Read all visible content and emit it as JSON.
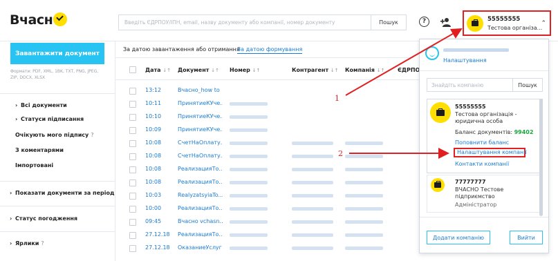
{
  "header": {
    "logo_text": "Вчасн",
    "search_placeholder": "Введіть ЄДРПОУ/ІПН, email, назву документу або компанії, номер документу",
    "search_button": "Пошук",
    "help_icon": "question-circle-icon",
    "add_user_icon": "add-user-icon",
    "account": {
      "id": "55555555",
      "name": "Тестова організа..."
    }
  },
  "sidebar": {
    "upload_button": "Завантажити документ",
    "formats": "Формати: PDF, XML, 1BK, TXT, PNG, JPEG, ZIP, DOCX, XLSX",
    "items": [
      {
        "label": "Всі документи",
        "chevron": true
      },
      {
        "label": "Статуси підписання",
        "chevron": true
      },
      {
        "label": "Очікують мого підпису",
        "help": "?"
      },
      {
        "label": "З коментарями"
      },
      {
        "label": "Імпортовані"
      },
      {
        "label": "Показати документи за період",
        "chevron": true
      },
      {
        "label": "Статус погодження",
        "chevron": true
      },
      {
        "label": "Ярлики",
        "chevron": true,
        "help": "?"
      }
    ]
  },
  "tabs": {
    "active": "За датою завантаження або отримання",
    "other": "За датою формування"
  },
  "table": {
    "columns": [
      "Дата",
      "Документ",
      "Номер",
      "Контрагент",
      "Компанія",
      "ЄДРПОУ"
    ],
    "sort_glyph": "↓↑",
    "rows": [
      {
        "time": "13:12",
        "doc": "Вчасно_how to",
        "blur": [
          false,
          false,
          false
        ]
      },
      {
        "time": "10:11",
        "doc": "ПринятиеКУче...",
        "blur": [
          true,
          false,
          false
        ]
      },
      {
        "time": "10:10",
        "doc": "ПринятиеКУче...",
        "blur": [
          true,
          false,
          false
        ]
      },
      {
        "time": "10:09",
        "doc": "ПринятиеКУче...",
        "blur": [
          true,
          false,
          false
        ]
      },
      {
        "time": "10:08",
        "doc": "СчетНаОплату...",
        "blur": [
          true,
          true,
          true
        ]
      },
      {
        "time": "10:08",
        "doc": "СчетНаОплату...",
        "blur": [
          true,
          true,
          true
        ]
      },
      {
        "time": "10:08",
        "doc": "РеализацияТо...",
        "blur": [
          true,
          true,
          true
        ]
      },
      {
        "time": "10:08",
        "doc": "РеализацияТо...",
        "blur": [
          true,
          true,
          true
        ]
      },
      {
        "time": "10:03",
        "doc": "RealyzatsyiaTo...",
        "blur": [
          true,
          true,
          true
        ]
      },
      {
        "time": "10:00",
        "doc": "РеализацияТо...",
        "blur": [
          true,
          true,
          true
        ]
      },
      {
        "time": "09:45",
        "doc": "Вчасно vchasn...",
        "blur": [
          true,
          true,
          true
        ]
      },
      {
        "time": "27.12.18",
        "doc": "РеализацияТо...",
        "blur": [
          true,
          true,
          true
        ]
      },
      {
        "time": "27.12.18",
        "doc": "ОказаниеУслуг",
        "blur": [
          true,
          true,
          true
        ]
      }
    ]
  },
  "dropdown": {
    "settings_link": "Налаштування",
    "search_placeholder": "Знайдіть компанію",
    "search_button": "Пошук",
    "companies": [
      {
        "id": "55555555",
        "name": "Тестова організація - юридична особа",
        "balance_label": "Баланс документів:",
        "balance_value": "99402",
        "topup_link": "Поповнити баланс",
        "settings_link": "Налаштування компанії",
        "contacts_link": "Контакти компанії"
      },
      {
        "id": "77777777",
        "name": "ВЧАСНО Тестове підприємство",
        "role": "Адміністратор"
      }
    ],
    "add_company_button": "Додати компанію",
    "logout_button": "Вийти"
  },
  "annotations": {
    "one": "1",
    "two": "2",
    "color": "#e02020"
  }
}
